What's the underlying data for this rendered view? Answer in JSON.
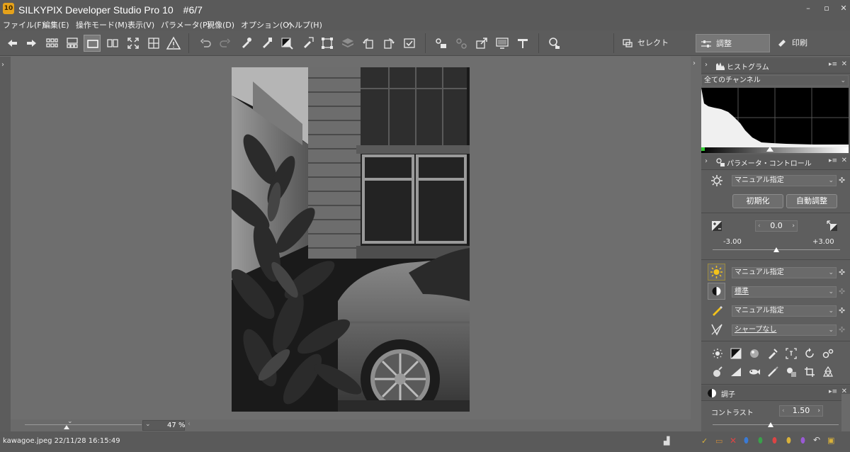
{
  "window": {
    "title": "SILKYPIX Developer Studio Pro 10　#6/7",
    "app_icon_text": "10",
    "minimize": "–",
    "restore": "▫",
    "close": "✕"
  },
  "menu": [
    "ファイル(F)",
    "編集(E)",
    "操作モード(M)",
    "表示(V)",
    "パラメータ(P)",
    "現像(D)",
    "オプション(O)",
    "ヘルプ(H)"
  ],
  "modes": {
    "select": "セレクト",
    "adjust": "調整",
    "print": "印刷"
  },
  "viewer": {
    "zoom_value": "47",
    "zoom_unit": "%"
  },
  "status": {
    "file_info": "kawagoe.jpeg 22/11/28 16:15:49"
  },
  "histogram": {
    "title": "ヒストグラム",
    "channel": "全てのチャンネル"
  },
  "param_control": {
    "title": "パラメータ・コントロール",
    "preset": "マニュアル指定",
    "reset_button": "初期化",
    "auto_button": "自動調整",
    "exposure": {
      "value": "0.0",
      "min": "-3.00",
      "max": "+3.00",
      "level": 0.5
    },
    "white_balance": "マニュアル指定",
    "tone": "標準",
    "color": "マニュアル指定",
    "sharpness": "シャープなし"
  },
  "tone_panel": {
    "title": "調子",
    "contrast_label": "コントラスト",
    "contrast_value": "1.50"
  },
  "colors": {
    "accent": "#e5a21b",
    "panel_bg": "#5e5e5e",
    "viewer_bg": "#6e6e6e"
  }
}
